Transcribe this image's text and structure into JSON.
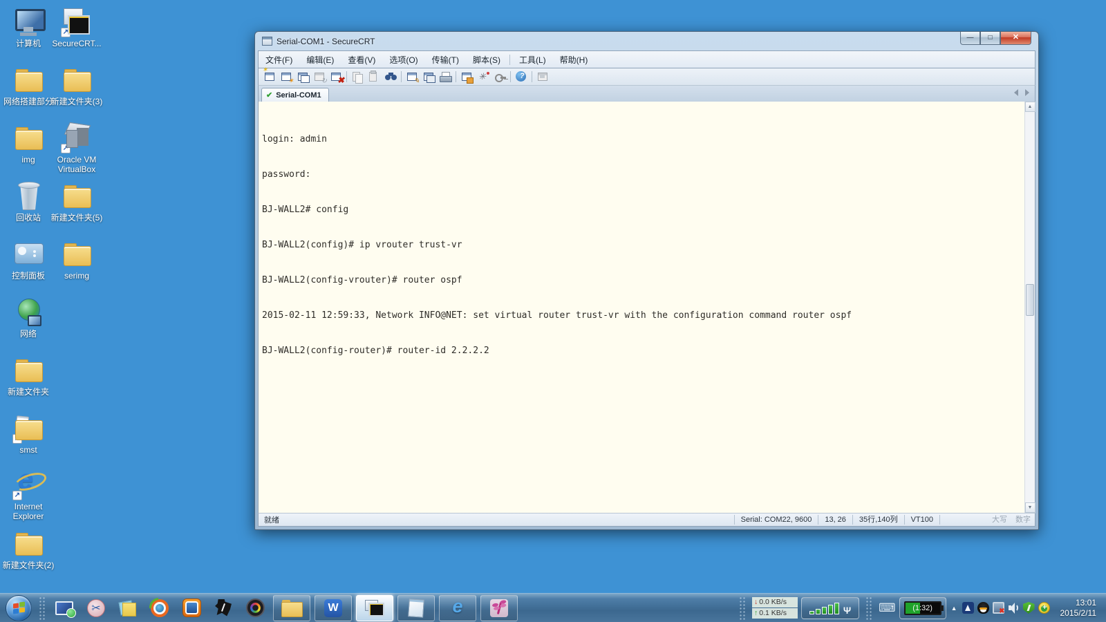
{
  "colors": {
    "desktop_bg": "#3E92D4",
    "terminal_bg": "#FFFDF0",
    "terminal_text": "#2E2C28",
    "titlebar": "#C9DCEE",
    "close_button_red": "#C13A22",
    "taskbar_blue": "#3C688F",
    "tab_check_green": "#33A033"
  },
  "desktop": {
    "icons": [
      {
        "label": "计算机",
        "type": "computer"
      },
      {
        "label": "SecureCRT...",
        "type": "securecrt-shortcut"
      },
      {
        "label": "网络搭建部分",
        "type": "folder"
      },
      {
        "label": "新建文件夹(3)",
        "type": "folder"
      },
      {
        "label": "img",
        "type": "folder"
      },
      {
        "label": "Oracle VM VirtualBox",
        "type": "virtualbox-shortcut"
      },
      {
        "label": "回收站",
        "type": "recycle-bin"
      },
      {
        "label": "新建文件夹(5)",
        "type": "folder"
      },
      {
        "label": "控制面板",
        "type": "control-panel"
      },
      {
        "label": "serimg",
        "type": "folder"
      },
      {
        "label": "网络",
        "type": "network"
      },
      {
        "label": "新建文件夹",
        "type": "folder"
      },
      {
        "label": "smst",
        "type": "folder-shortcut"
      },
      {
        "label": "Internet Explorer",
        "type": "ie-shortcut"
      },
      {
        "label": "新建文件夹(2)",
        "type": "folder"
      }
    ]
  },
  "window": {
    "title": "Serial-COM1 - SecureCRT",
    "menu": [
      "文件(F)",
      "编辑(E)",
      "查看(V)",
      "选项(O)",
      "传输(T)",
      "脚本(S)",
      "工具(L)",
      "帮助(H)"
    ],
    "toolbar_icons": [
      "connect",
      "quick-connect",
      "session-tabs",
      "reconnect",
      "disconnect",
      "copy",
      "paste",
      "find",
      "print-setup",
      "print-preview",
      "print",
      "session-options",
      "keymap-editor",
      "key-agent",
      "help",
      "about"
    ],
    "tab": {
      "label": "Serial-COM1",
      "status": "connected"
    },
    "terminal": {
      "lines": [
        "login: admin",
        "password:",
        "BJ-WALL2# config",
        "BJ-WALL2(config)# ip vrouter trust-vr",
        "BJ-WALL2(config-vrouter)# router ospf",
        "2015-02-11 12:59:33, Network INFO@NET: set virtual router trust-vr with the configuration command router ospf",
        "BJ-WALL2(config-router)# router-id 2.2.2.2"
      ]
    },
    "statusbar": {
      "ready": "就绪",
      "serial": "Serial: COM22, 9600",
      "cursor": "13, 26",
      "grid": "35行,140列",
      "emulation": "VT100",
      "caps": "大写",
      "num": "数字"
    }
  },
  "taskbar": {
    "pinned": [
      "remote-desktop",
      "screenshot-tool",
      "sticky-notes",
      "screen-recorder",
      "vmware",
      "circuit-tool",
      "camera"
    ],
    "apps": [
      "windows-explorer",
      "wps-writer",
      "securecrt",
      "notepad",
      "internet-explorer",
      "dragonfly-app"
    ],
    "active_app": "securecrt",
    "tray": {
      "net_down": "0.0 KB/s",
      "net_up": "0.1 KB/s",
      "battery_time": "(1:32)",
      "clock_time": "13:01",
      "clock_date": "2015/2/11"
    }
  }
}
